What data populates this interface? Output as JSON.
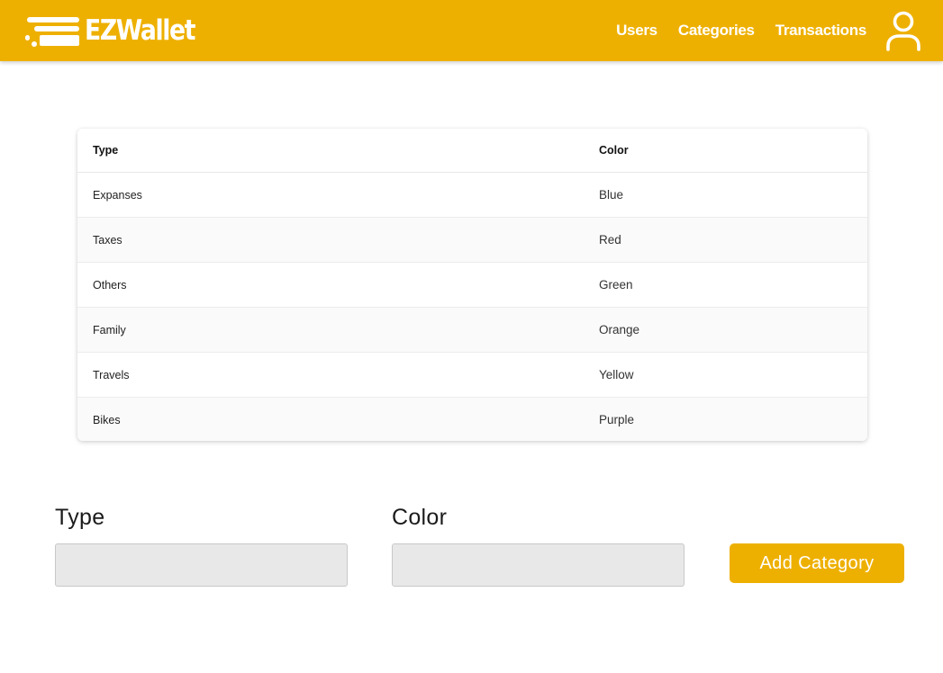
{
  "app": {
    "logo_text": "EZWallet",
    "brand_color": "#eeb000"
  },
  "nav": {
    "links": [
      {
        "label": "Users"
      },
      {
        "label": "Categories"
      },
      {
        "label": "Transactions"
      }
    ],
    "user_icon": "user-icon"
  },
  "table": {
    "headers": {
      "type": "Type",
      "color": "Color"
    },
    "rows": [
      {
        "type": "Expanses",
        "color": "Blue"
      },
      {
        "type": "Taxes",
        "color": "Red"
      },
      {
        "type": "Others",
        "color": "Green"
      },
      {
        "type": "Family",
        "color": "Orange"
      },
      {
        "type": "Travels",
        "color": "Yellow"
      },
      {
        "type": "Bikes",
        "color": "Purple"
      }
    ]
  },
  "form": {
    "type_label": "Type",
    "type_value": "",
    "color_label": "Color",
    "color_value": "",
    "submit_label": "Add Category"
  }
}
